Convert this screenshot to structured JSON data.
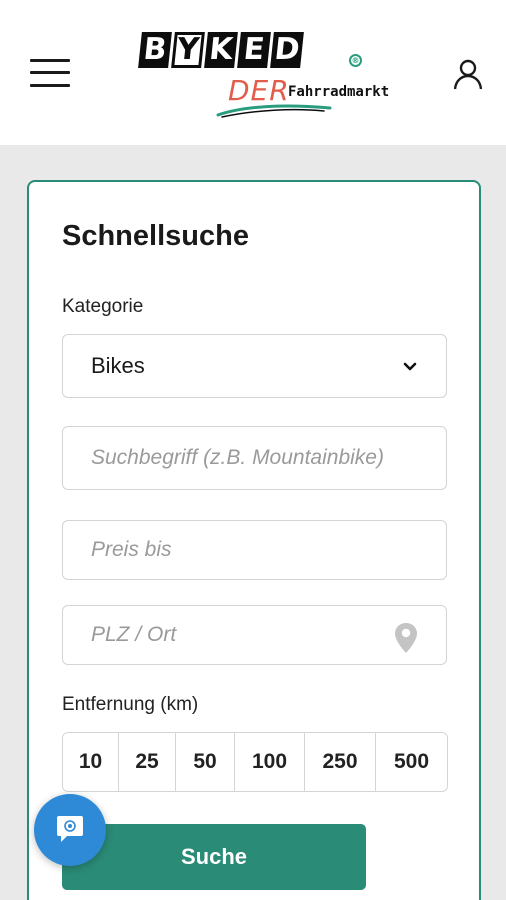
{
  "header": {
    "logo": {
      "letters": [
        "B",
        "Y",
        "K",
        "E",
        "D"
      ],
      "registered": "®",
      "tagline_der": "DER",
      "tagline_rest": "Fahrradmarkt"
    },
    "menu_icon": "hamburger-menu-icon",
    "user_icon": "user-account-icon"
  },
  "search_form": {
    "title": "Schnellsuche",
    "category_label": "Kategorie",
    "category_value": "Bikes",
    "keyword_placeholder": "Suchbegriff (z.B. Mountainbike)",
    "price_placeholder": "Preis bis",
    "location_placeholder": "PLZ / Ort",
    "distance_label": "Entfernung (km)",
    "distance_options": [
      "10",
      "25",
      "50",
      "100",
      "250",
      "500"
    ],
    "submit_label": "Suche"
  },
  "colors": {
    "brand_green": "#2a8b76",
    "accent_red": "#e25d4b",
    "chat_blue": "#2e8ad6"
  }
}
